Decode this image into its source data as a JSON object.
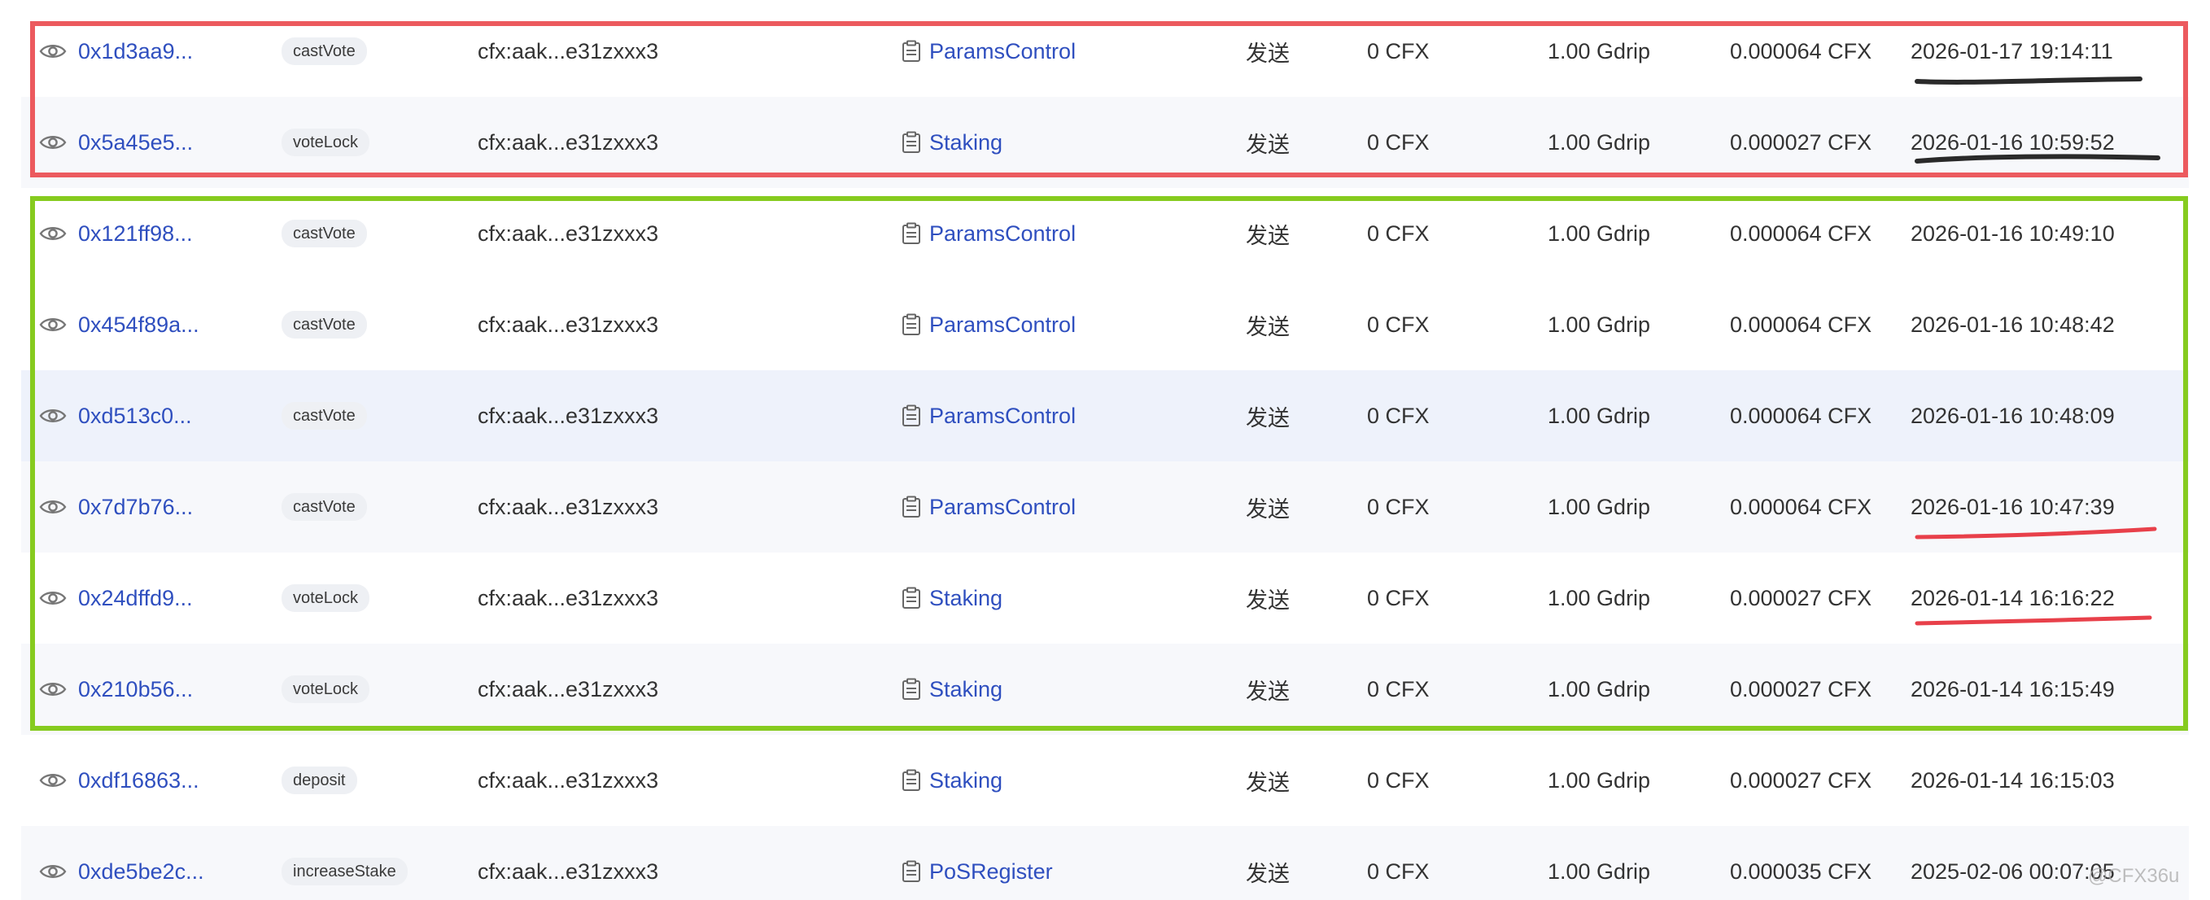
{
  "transactions": [
    {
      "hash": "0x1d3aa9...",
      "method": "castVote",
      "from": "cfx:aak...e31zxxx3",
      "to": "ParamsControl",
      "direction": "发送",
      "value": "0 CFX",
      "gas_price": "1.00 Gdrip",
      "fee": "0.000064 CFX",
      "time": "2026-01-17 19:14:11"
    },
    {
      "hash": "0x5a45e5...",
      "method": "voteLock",
      "from": "cfx:aak...e31zxxx3",
      "to": "Staking",
      "direction": "发送",
      "value": "0 CFX",
      "gas_price": "1.00 Gdrip",
      "fee": "0.000027 CFX",
      "time": "2026-01-16 10:59:52"
    },
    {
      "hash": "0x121ff98...",
      "method": "castVote",
      "from": "cfx:aak...e31zxxx3",
      "to": "ParamsControl",
      "direction": "发送",
      "value": "0 CFX",
      "gas_price": "1.00 Gdrip",
      "fee": "0.000064 CFX",
      "time": "2026-01-16 10:49:10"
    },
    {
      "hash": "0x454f89a...",
      "method": "castVote",
      "from": "cfx:aak...e31zxxx3",
      "to": "ParamsControl",
      "direction": "发送",
      "value": "0 CFX",
      "gas_price": "1.00 Gdrip",
      "fee": "0.000064 CFX",
      "time": "2026-01-16 10:48:42"
    },
    {
      "hash": "0xd513c0...",
      "method": "castVote",
      "from": "cfx:aak...e31zxxx3",
      "to": "ParamsControl",
      "direction": "发送",
      "value": "0 CFX",
      "gas_price": "1.00 Gdrip",
      "fee": "0.000064 CFX",
      "time": "2026-01-16 10:48:09"
    },
    {
      "hash": "0x7d7b76...",
      "method": "castVote",
      "from": "cfx:aak...e31zxxx3",
      "to": "ParamsControl",
      "direction": "发送",
      "value": "0 CFX",
      "gas_price": "1.00 Gdrip",
      "fee": "0.000064 CFX",
      "time": "2026-01-16 10:47:39"
    },
    {
      "hash": "0x24dffd9...",
      "method": "voteLock",
      "from": "cfx:aak...e31zxxx3",
      "to": "Staking",
      "direction": "发送",
      "value": "0 CFX",
      "gas_price": "1.00 Gdrip",
      "fee": "0.000027 CFX",
      "time": "2026-01-14 16:16:22"
    },
    {
      "hash": "0x210b56...",
      "method": "voteLock",
      "from": "cfx:aak...e31zxxx3",
      "to": "Staking",
      "direction": "发送",
      "value": "0 CFX",
      "gas_price": "1.00 Gdrip",
      "fee": "0.000027 CFX",
      "time": "2026-01-14 16:15:49"
    },
    {
      "hash": "0xdf16863...",
      "method": "deposit",
      "from": "cfx:aak...e31zxxx3",
      "to": "Staking",
      "direction": "发送",
      "value": "0 CFX",
      "gas_price": "1.00 Gdrip",
      "fee": "0.000027 CFX",
      "time": "2026-01-14 16:15:03"
    },
    {
      "hash": "0xde5be2c...",
      "method": "increaseStake",
      "from": "cfx:aak...e31zxxx3",
      "to": "PoSRegister",
      "direction": "发送",
      "value": "0 CFX",
      "gas_price": "1.00 Gdrip",
      "fee": "0.000035 CFX",
      "time": "2025-02-06 00:07:05"
    }
  ],
  "colors": {
    "link": "#2f4fbf",
    "red_box": "#ec5a5e",
    "green_box": "#86cb1f",
    "black_underline": "#2a2a2a",
    "red_underline": "#e8404a"
  },
  "icons": {
    "row_preview": "eye-icon",
    "contract": "document-icon"
  },
  "watermark": "@CFX36u"
}
